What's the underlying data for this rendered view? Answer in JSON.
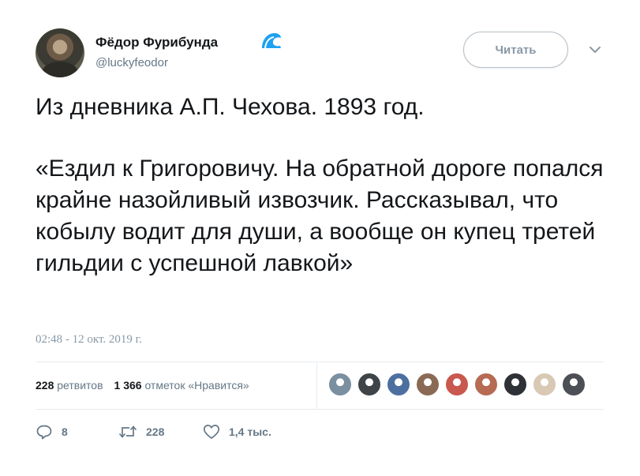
{
  "author": {
    "display_name": "Фёдор Фурибунда",
    "handle": "@luckyfeodor",
    "badge_icon": "wave-icon"
  },
  "follow_button": {
    "label": "Читать"
  },
  "menu_caret_icon": "chevron-down-icon",
  "tweet": {
    "paragraphs": [
      "Из дневника А.П. Чехова. 1893 год.",
      "«Ездил к Григоровичу. На обратной дороге попался крайне назойливый извозчик. Рассказывал, что кобылу водит для души, а вообще он купец третей гильдии с успешной лавкой»"
    ],
    "timestamp": "02:48 - 12 окт. 2019 г."
  },
  "stats": {
    "retweets_count": "228",
    "retweets_label": "ретвитов",
    "likes_count": "1 366",
    "likes_label": "отметок «Нравится»"
  },
  "liker_avatars": [
    {
      "name": "liker-1",
      "color": "#7a8fa0"
    },
    {
      "name": "liker-2",
      "color": "#3e4447"
    },
    {
      "name": "liker-3",
      "color": "#4d6fa0"
    },
    {
      "name": "liker-4",
      "color": "#8a6a55"
    },
    {
      "name": "liker-5",
      "color": "#c9584f"
    },
    {
      "name": "liker-6",
      "color": "#b66b52"
    },
    {
      "name": "liker-7",
      "color": "#2e3136"
    },
    {
      "name": "liker-8",
      "color": "#d8c8b4"
    },
    {
      "name": "liker-9",
      "color": "#4c4f55"
    }
  ],
  "actions": {
    "replies": "8",
    "retweets": "228",
    "likes": "1,4 тыс."
  },
  "colors": {
    "text": "#14171a",
    "secondary": "#657786",
    "wave": "#1da1f2"
  }
}
